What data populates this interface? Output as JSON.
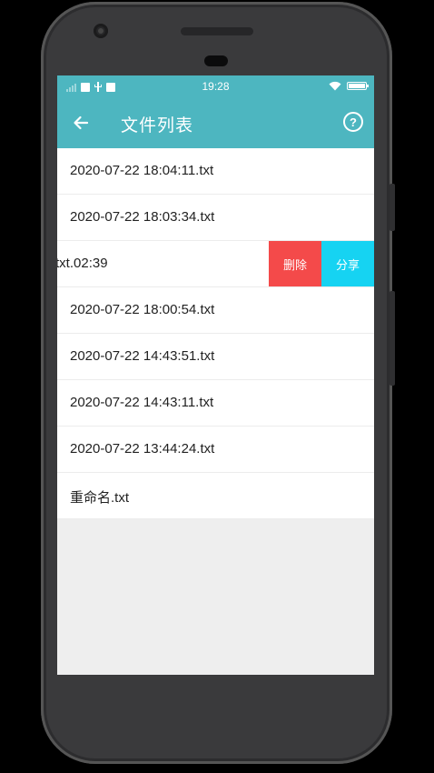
{
  "status_bar": {
    "time": "19:28"
  },
  "toolbar": {
    "title": "文件列表",
    "back_icon": "arrow-left-icon",
    "help_icon": "help-circle-icon",
    "help_glyph": "?"
  },
  "files": [
    {
      "name": "2020-07-22 18:04:11.txt"
    },
    {
      "name": "2020-07-22 18:03:34.txt"
    },
    {
      "name": "02:39.txt",
      "swiped": true
    },
    {
      "name": "2020-07-22 18:00:54.txt"
    },
    {
      "name": "2020-07-22 14:43:51.txt"
    },
    {
      "name": "2020-07-22 14:43:11.txt"
    },
    {
      "name": "2020-07-22 13:44:24.txt"
    },
    {
      "name": "重命名.txt"
    }
  ],
  "swipe_actions": {
    "delete_label": "删除",
    "share_label": "分享"
  },
  "colors": {
    "accent": "#4db6c0",
    "delete": "#f44a4a",
    "share": "#16d3f2"
  }
}
